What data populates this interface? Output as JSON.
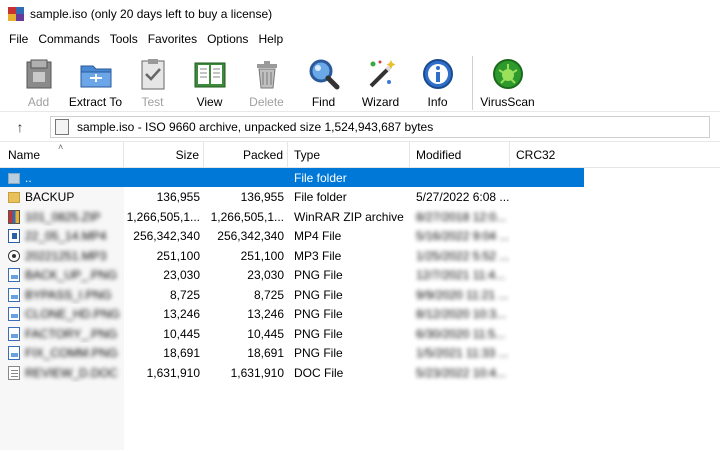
{
  "window": {
    "title": "sample.iso (only 20 days left to buy a license)"
  },
  "menu": [
    "File",
    "Commands",
    "Tools",
    "Favorites",
    "Options",
    "Help"
  ],
  "toolbar": [
    {
      "label": "Add",
      "icon": "add-archive-icon",
      "enabled": false
    },
    {
      "label": "Extract To",
      "icon": "extract-folder-icon",
      "enabled": true
    },
    {
      "label": "Test",
      "icon": "test-clipboard-icon",
      "enabled": false
    },
    {
      "label": "View",
      "icon": "view-book-icon",
      "enabled": true
    },
    {
      "label": "Delete",
      "icon": "trash-icon",
      "enabled": false
    },
    {
      "label": "Find",
      "icon": "magnifier-icon",
      "enabled": true
    },
    {
      "label": "Wizard",
      "icon": "magic-wand-icon",
      "enabled": true
    },
    {
      "label": "Info",
      "icon": "info-icon",
      "enabled": true
    },
    {
      "label": "VirusScan",
      "icon": "virus-scan-icon",
      "enabled": true
    }
  ],
  "address": {
    "text": "sample.iso - ISO 9660 archive, unpacked size 1,524,943,687 bytes"
  },
  "columns": {
    "name": "Name",
    "size": "Size",
    "packed": "Packed",
    "type": "Type",
    "modified": "Modified",
    "crc": "CRC32"
  },
  "files": [
    {
      "name": "..",
      "size": "",
      "packed": "",
      "type": "File folder",
      "modified": "",
      "icon": "folder-up-icon",
      "selected": true
    },
    {
      "name": "BACKUP",
      "size": "136,955",
      "packed": "136,955",
      "type": "File folder",
      "modified": "5/27/2022 6:08 ...",
      "icon": "folder-icon"
    },
    {
      "name": "101_0825.ZIP",
      "size": "1,266,505,1...",
      "packed": "1,266,505,1...",
      "type": "WinRAR ZIP archive",
      "modified": "8/27/2018 12:0...",
      "icon": "zip-icon"
    },
    {
      "name": "22_05_14.MP4",
      "size": "256,342,340",
      "packed": "256,342,340",
      "type": "MP4 File",
      "modified": "5/16/2022 9:04 ...",
      "icon": "video-file-icon"
    },
    {
      "name": "20221251.MP3",
      "size": "251,100",
      "packed": "251,100",
      "type": "MP3 File",
      "modified": "1/25/2022 5:52 ...",
      "icon": "audio-file-icon"
    },
    {
      "name": "BACK_UP_.PNG",
      "size": "23,030",
      "packed": "23,030",
      "type": "PNG File",
      "modified": "12/7/2021 11:4...",
      "icon": "image-file-icon"
    },
    {
      "name": "BYPASS_I.PNG",
      "size": "8,725",
      "packed": "8,725",
      "type": "PNG File",
      "modified": "9/9/2020 11:21 ...",
      "icon": "image-file-icon"
    },
    {
      "name": "CLONE_HD.PNG",
      "size": "13,246",
      "packed": "13,246",
      "type": "PNG File",
      "modified": "8/12/2020 10:3...",
      "icon": "image-file-icon"
    },
    {
      "name": "FACTORY_.PNG",
      "size": "10,445",
      "packed": "10,445",
      "type": "PNG File",
      "modified": "6/30/2020 11:5...",
      "icon": "image-file-icon"
    },
    {
      "name": "FIX_COMM.PNG",
      "size": "18,691",
      "packed": "18,691",
      "type": "PNG File",
      "modified": "1/5/2021 11:33 ...",
      "icon": "image-file-icon"
    },
    {
      "name": "REVIEW_D.DOC",
      "size": "1,631,910",
      "packed": "1,631,910",
      "type": "DOC File",
      "modified": "5/23/2022 10:4...",
      "icon": "document-file-icon"
    }
  ]
}
